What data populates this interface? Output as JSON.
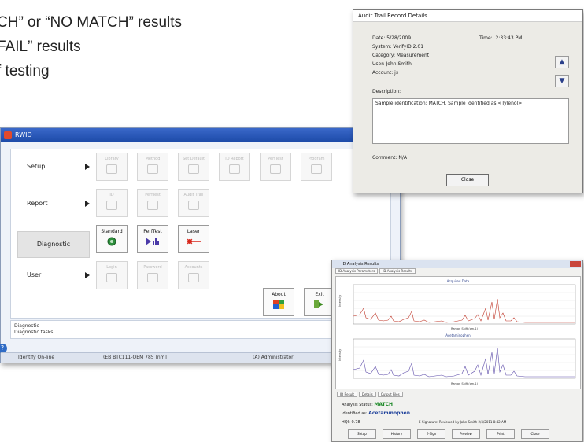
{
  "bullets": [
    "CH” or “NO MATCH” results",
    "FAIL” results",
    "f testing"
  ],
  "main_window": {
    "title": "RWID",
    "rows": [
      {
        "label": "Setup",
        "buttons": [
          "Library",
          "Method",
          "Set Default",
          "ID Report",
          "PerfTest",
          "Program"
        ]
      },
      {
        "label": "Report",
        "buttons": [
          "ID",
          "PerfTest",
          "Audit Trail"
        ]
      },
      {
        "label": "Diagnostic",
        "buttons": [
          "Standard",
          "PerfTest",
          "Laser"
        ]
      },
      {
        "label": "User",
        "buttons": [
          "Login",
          "Password",
          "Accounts"
        ]
      }
    ],
    "about_label": "About",
    "exit_label": "Exit",
    "status_title": "Diagnostic",
    "status_text": "Diagnostic tasks",
    "statusbar": {
      "left": "Identify On-line",
      "middle": "(EB BTC111-OEM 785 [nm]",
      "right": "(A) Administrator"
    },
    "help_icon": "question-icon"
  },
  "audit_window": {
    "title": "Audit Trail Record Details",
    "date_label": "Date:",
    "date_value": "5/28/2009",
    "time_label": "Time:",
    "time_value": "2:33:43 PM",
    "system_label": "System:",
    "system_value": "VerifyID 2.01",
    "category_label": "Category:",
    "category_value": "Measurement",
    "user_label": "User:",
    "user_value": "John Smith",
    "account_label": "Account:",
    "account_value": "js",
    "description_label": "Description:",
    "description_text": "Sample identification: MATCH. Sample identified as <Tylenol>",
    "comment_label": "Comment:",
    "comment_value": "N/A",
    "close_label": "Close"
  },
  "id_window": {
    "title": "ID Analysis Results",
    "tabs": [
      "ID Analysis Parameters",
      "ID Analysis Results"
    ],
    "top_chart_title": "Acquired Data",
    "bottom_chart_title": "Acetaminophen",
    "x_axis_label": "Raman Shift (cm-1)",
    "y_axis_label": "Intensity",
    "bottom_tabs": [
      "ID Result",
      "Details",
      "Output Files"
    ],
    "analysis_status_label": "Analysis Status:",
    "analysis_status_value": "MATCH",
    "identified_label": "Identified as:",
    "identified_value": "Acetaminophen",
    "hqi_label": "HQI:",
    "hqi_value": "0.78",
    "esignature": "E-Signature:  Reviewed by John Smith   2/4/2011  8:42 AM",
    "buttons": [
      "Setup",
      "History",
      "E-Sign",
      "Preview",
      "Print",
      "Close"
    ]
  },
  "colors": {
    "title_blue": "#2a56b8",
    "red_spectrum": "#c0392b",
    "purple_spectrum": "#5b4aa8",
    "match_green": "#1f8a2a",
    "identified_blue": "#1c3f9a"
  }
}
